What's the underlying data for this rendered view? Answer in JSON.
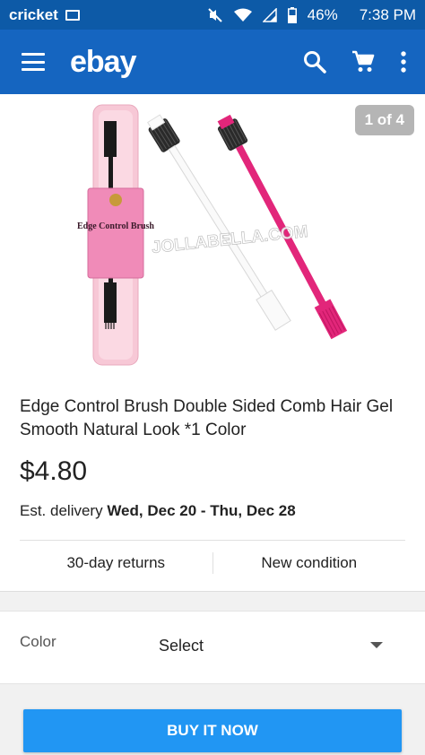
{
  "status_bar": {
    "carrier": "cricket",
    "battery": "46%",
    "time": "7:38 PM"
  },
  "app_bar": {
    "logo": "ebay",
    "icons": [
      "menu-icon",
      "search-icon",
      "cart-icon",
      "more-vert-icon"
    ]
  },
  "listing": {
    "image_counter": "1 of 4",
    "watermark": "JOLLABELLA.COM",
    "package_text": "Edge Control Brush",
    "title": "Edge Control Brush Double Sided Comb Hair Gel Smooth Natural Look *1 Color",
    "price": "$4.80",
    "delivery_prefix": "Est. delivery ",
    "delivery_dates": "Wed, Dec 20 - Thu, Dec 28",
    "returns": "30-day returns",
    "condition": "New condition"
  },
  "variation": {
    "label": "Color",
    "value": "Select"
  },
  "buy_button": "BUY IT NOW",
  "colors": {
    "status_bar": "#0d5aa7",
    "app_bar": "#1565c0",
    "buy_button": "#2196f3",
    "pink_brush": "#e2267a",
    "counter_badge": "#b5b5b5"
  }
}
